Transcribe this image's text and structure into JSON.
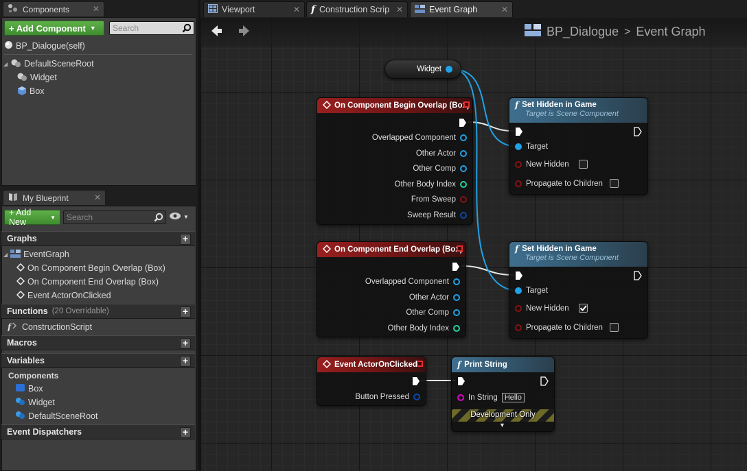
{
  "components_panel": {
    "tab_label": "Components",
    "add_button": "+ Add Component",
    "search_placeholder": "Search",
    "self_item": "BP_Dialogue(self)",
    "tree": [
      "DefaultSceneRoot",
      "Widget",
      "Box"
    ]
  },
  "my_blueprint": {
    "tab_label": "My Blueprint",
    "add_button": "+ Add New",
    "search_placeholder": "Search",
    "graphs_label": "Graphs",
    "event_graph": "EventGraph",
    "events": [
      "On Component Begin Overlap (Box)",
      "On Component End Overlap (Box)",
      "Event ActorOnClicked"
    ],
    "functions_label": "Functions",
    "functions_sub": "(20 Overridable)",
    "construction_script": "ConstructionScript",
    "macros_label": "Macros",
    "variables_label": "Variables",
    "components_label": "Components",
    "var_components": [
      "Box",
      "Widget",
      "DefaultSceneRoot"
    ],
    "dispatchers_label": "Event Dispatchers"
  },
  "doc_tabs": [
    "Viewport",
    "Construction Scrip",
    "Event Graph"
  ],
  "breadcrumb": {
    "blueprint": "BP_Dialogue",
    "separator": ">",
    "graph": "Event Graph"
  },
  "nodes": {
    "widget_var": "Widget",
    "begin_overlap": {
      "title": "On Component Begin Overlap (Box)",
      "pins": [
        "Overlapped Component",
        "Other Actor",
        "Other Comp",
        "Other Body Index",
        "From Sweep",
        "Sweep Result"
      ]
    },
    "end_overlap": {
      "title": "On Component End Overlap (Box)",
      "pins": [
        "Overlapped Component",
        "Other Actor",
        "Other Comp",
        "Other Body Index"
      ]
    },
    "set_hidden_1": {
      "title": "Set Hidden in Game",
      "subtitle": "Target is Scene Component",
      "target": "Target",
      "new_hidden": "New Hidden",
      "propagate": "Propagate to Children",
      "new_hidden_checked": false
    },
    "set_hidden_2": {
      "title": "Set Hidden in Game",
      "subtitle": "Target is Scene Component",
      "target": "Target",
      "new_hidden": "New Hidden",
      "propagate": "Propagate to Children",
      "new_hidden_checked": true
    },
    "actor_clicked": {
      "title": "Event ActorOnClicked",
      "pin": "Button Pressed"
    },
    "print_string": {
      "title": "Print String",
      "in_string_label": "In String",
      "in_string_value": "Hello",
      "dev_only": "Development Only"
    }
  },
  "colors": {
    "event_header": "#9a1f1f",
    "function_header": "#3f6f8f",
    "object_pin": "#1fa3e8",
    "int_pin": "#1ed6a4",
    "bool_pin": "#8e1010",
    "string_pin": "#e000c8",
    "exec_wire": "#ffffff"
  }
}
